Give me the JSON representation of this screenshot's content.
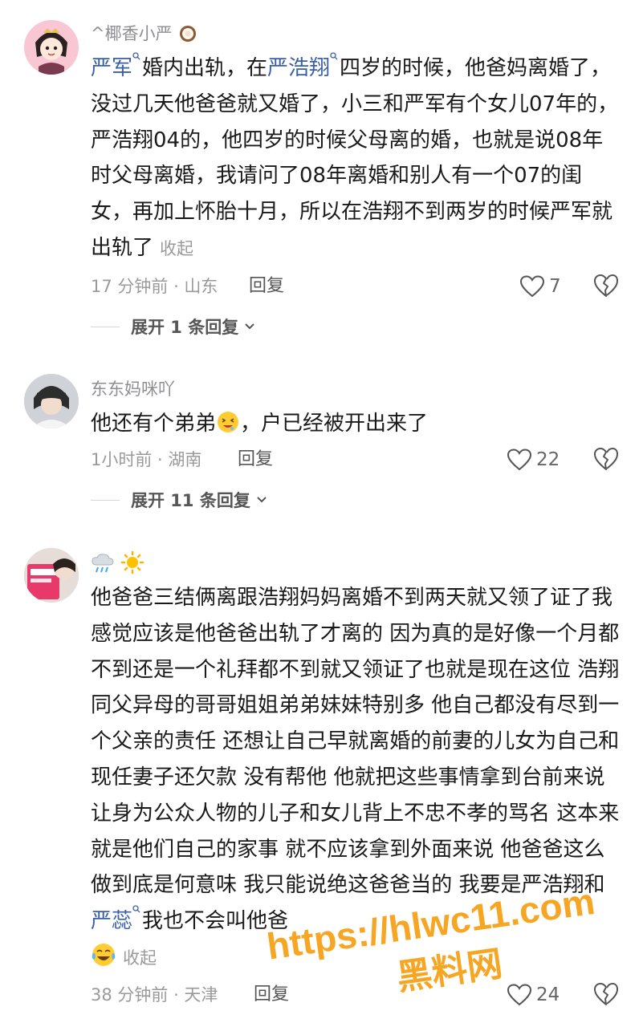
{
  "comments": [
    {
      "username": "^椰香小严",
      "username_icon": "coconut-icon",
      "segments": [
        {
          "t": "link",
          "v": "严军"
        },
        {
          "t": "text",
          "v": "婚内出轨，在"
        },
        {
          "t": "link",
          "v": "严浩翔"
        },
        {
          "t": "text",
          "v": "四岁的时候，他爸妈离婚了，没过几天他爸爸就又婚了，小三和严军有个女儿07年的，严浩翔04的，他四岁的时候父母离的婚，也就是说08年时父母离婚，我请问了08年离婚和别人有一个07的闺女，再加上怀胎十月，所以在浩翔不到两岁的时候严军就出轨了"
        }
      ],
      "collapse": "收起",
      "time": "17 分钟前 · 山东",
      "reply": "回复",
      "likes": "7",
      "expand": "展开 1 条回复"
    },
    {
      "username": "东东妈咪吖",
      "text_before": "他还有个弟弟",
      "emoji": "drooling-face-icon",
      "text_after": "，户已经被开出来了",
      "time": "1小时前 · 湖南",
      "reply": "回复",
      "likes": "22",
      "expand": "展开 11 条回复"
    },
    {
      "username_icons": [
        "rain-cloud-icon",
        "sun-icon"
      ],
      "body": "他爸爸三结俩离跟浩翔妈妈离婚不到两天就又领了证了我感觉应该是他爸爸出轨了才离的 因为真的是好像一个月都不到还是一个礼拜都不到就又领证了也就是现在这位 浩翔同父异母的哥哥姐姐弟弟妹妹特别多 他自己都没有尽到一个父亲的责任 还想让自己早就离婚的前妻的儿女为自己和现任妻子还欠款 没有帮他 他就把这些事情拿到台前来说让身为公众人物的儿子和女儿背上不忠不孝的骂名 这本来就是他们自己的家事 就不应该拿到外面来说 他爸爸这么做到底是何意味 我只能说绝这爸爸当的 我要是严浩翔和",
      "link": "严蕊",
      "body_end": "我也不会叫他爸",
      "end_emoji": "crying-laughing-icon",
      "collapse": "收起",
      "time": "38 分钟前 · 天津",
      "reply": "回复",
      "likes": "24"
    }
  ],
  "watermark": {
    "line1": "https://hlwc11.com",
    "line2": "黑料网"
  },
  "colors": {
    "link": "#3a5fa8",
    "muted": "#9a9a9a",
    "watermark_fill": "#f6a623"
  }
}
